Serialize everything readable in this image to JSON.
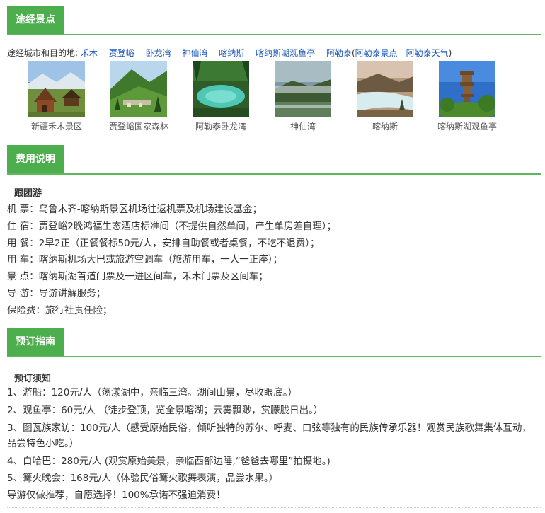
{
  "route": {
    "section_title": "途经景点",
    "cities_label": "途经城市和目的地:",
    "cities": [
      "禾木",
      "贾登峪",
      "卧龙湾",
      "神仙湾",
      "喀纳斯",
      "喀纳斯湖观鱼亭",
      "阿勒泰"
    ],
    "extra_links": [
      "阿勒泰景点",
      "阿勒泰天气"
    ],
    "paren_open": "(",
    "paren_close": ")",
    "photos": [
      {
        "caption": "新疆禾木景区",
        "icon": "hemu-village-photo"
      },
      {
        "caption": "贾登峪国家森林",
        "icon": "jiadengyu-forest-photo"
      },
      {
        "caption": "阿勒泰卧龙湾",
        "icon": "wolong-bay-photo"
      },
      {
        "caption": "神仙湾",
        "icon": "shenxian-bay-photo"
      },
      {
        "caption": "喀纳斯",
        "icon": "kanas-photo"
      },
      {
        "caption": "喀纳斯湖观鱼亭",
        "icon": "fish-watching-pavilion-photo"
      }
    ]
  },
  "fees": {
    "section_title": "费用说明",
    "group_title": "跟团游",
    "items": [
      "机 票：乌鲁木齐-喀纳斯景区机场往返机票及机场建设基金；",
      "住 宿：贾登峪2晚鸿福生态酒店标准间（不提供自然单间，产生单房差自理）；",
      "用 餐：2早2正（正餐餐标50元/人，安排自助餐或者桌餐，不吃不退费）；",
      "用 车：喀纳斯机场大巴或旅游空调车（旅游用车，一人一正座）；",
      "景 点：喀纳斯湖首道门票及一进区间车，禾木门票及区间车；",
      "导 游：导游讲解服务；",
      "保险费：旅行社责任险；"
    ]
  },
  "booking": {
    "section_title": "预订指南",
    "notice_title": "预订须知",
    "items": [
      "1、游船：120元/人（荡漾湖中，亲临三湾。湖间山景，尽收眼底。）",
      "2、观鱼亭：60元/人 （徒步登顶，览全景喀湖；云雾飘渺，赏朦胧日出。）",
      "3、图瓦族家访：100元/人（感受原始民俗，倾听独特的苏尔、呼麦、口弦等独有的民族传承乐器！观赏民族歌舞集体互动，品尝特色小吃。）",
      "4、白哈巴：280元/人 (观赏原始美景，亲临西部边陲,“爸爸去哪里”拍摄地。)",
      "5、篝火晚会：168元/人（体验民俗篝火歌舞表演，品尝水果。）",
      "导游仅做推荐，自愿选择！100%承诺不强迫消费！"
    ]
  },
  "colors": {
    "accent": "#4cae4c",
    "link": "#1a56b8"
  }
}
